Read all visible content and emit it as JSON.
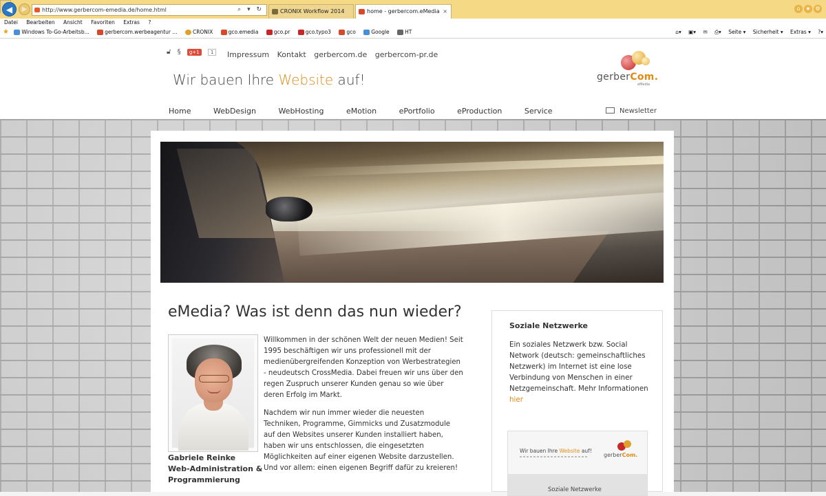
{
  "browser": {
    "address": "http://www.gerbercom-emedia.de/home.html",
    "address_tools": "⌕ ▾ ↻",
    "tabs": [
      {
        "label": "CRONIX Workflow 2014"
      },
      {
        "label": "home - gerbercom.eMedia"
      }
    ],
    "menu": [
      "Datei",
      "Bearbeiten",
      "Ansicht",
      "Favoriten",
      "Extras",
      "?"
    ],
    "favorites": [
      "Windows To-Go-Arbeitsb...",
      "gerbercom.werbeagentur ...",
      "CRONIX",
      "gco.emedia",
      "gco.pr",
      "gco.typo3",
      "gco",
      "Google",
      "HT"
    ],
    "command_bar": [
      "Seite ▾",
      "Sicherheit ▾",
      "Extras ▾"
    ]
  },
  "header": {
    "topnav": [
      "Impressum",
      "Kontakt",
      "gerbercom.de",
      "gerbercom-pr.de"
    ],
    "gplus_label": "g+1",
    "gplus_count": "1",
    "slogan_pre": "Wir bauen Ihre ",
    "slogan_hl": "Website",
    "slogan_post": " auf!",
    "logo_word": "gerber",
    "logo_word_hl": "Com.",
    "logo_sub": "eMedia"
  },
  "mainnav": [
    "Home",
    "WebDesign",
    "WebHosting",
    "eMotion",
    "ePortfolio",
    "eProduction",
    "Service"
  ],
  "newsletter": "Newsletter",
  "article": {
    "headline": "eMedia? Was ist denn das nun wieder?",
    "caption": [
      "Gabriele Reinke",
      "Web-Administration &",
      "Programmierung"
    ],
    "paragraphs": [
      "Willkommen in der schönen Welt der neuen Medien! Seit 1995 beschäftigen wir uns professionell mit der medienübergreifenden Konzeption von Werbestrategien - neudeutsch CrossMedia. Dabei freuen wir uns über den regen Zuspruch unserer Kunden genau so wie über deren Erfolg im Markt.",
      "Nachdem wir nun immer wieder die neuesten Techniken, Programme, Gimmicks und Zusatzmodule auf den Websites unserer Kunden installiert haben, haben wir uns entschlossen, die eingesetzten Möglichkeiten auf einer eigenen Website darzustellen. Und vor allem: einen eigenen Begriff dafür zu kreieren!"
    ]
  },
  "sidebar": {
    "title": "Soziale Netzwerke",
    "text": "Ein soziales Netzwerk bzw. Social Network (deutsch: gemeinschaftliches Netzwerk) im Internet ist eine lose Verbindung von Menschen in einer Netzgemeinschaft. Mehr Informationen ",
    "link": "hier",
    "mini_slogan_pre": "Wir bauen Ihre ",
    "mini_slogan_hl": "Website",
    "mini_slogan_post": " auf!",
    "mini_logo_word": "gerber",
    "mini_logo_hl": "Com.",
    "mini_title": "Soziale Netzwerke"
  },
  "colors": {
    "accent": "#e08b17",
    "chrome_title": "#f5d985",
    "back_button": "#2a79c5"
  }
}
